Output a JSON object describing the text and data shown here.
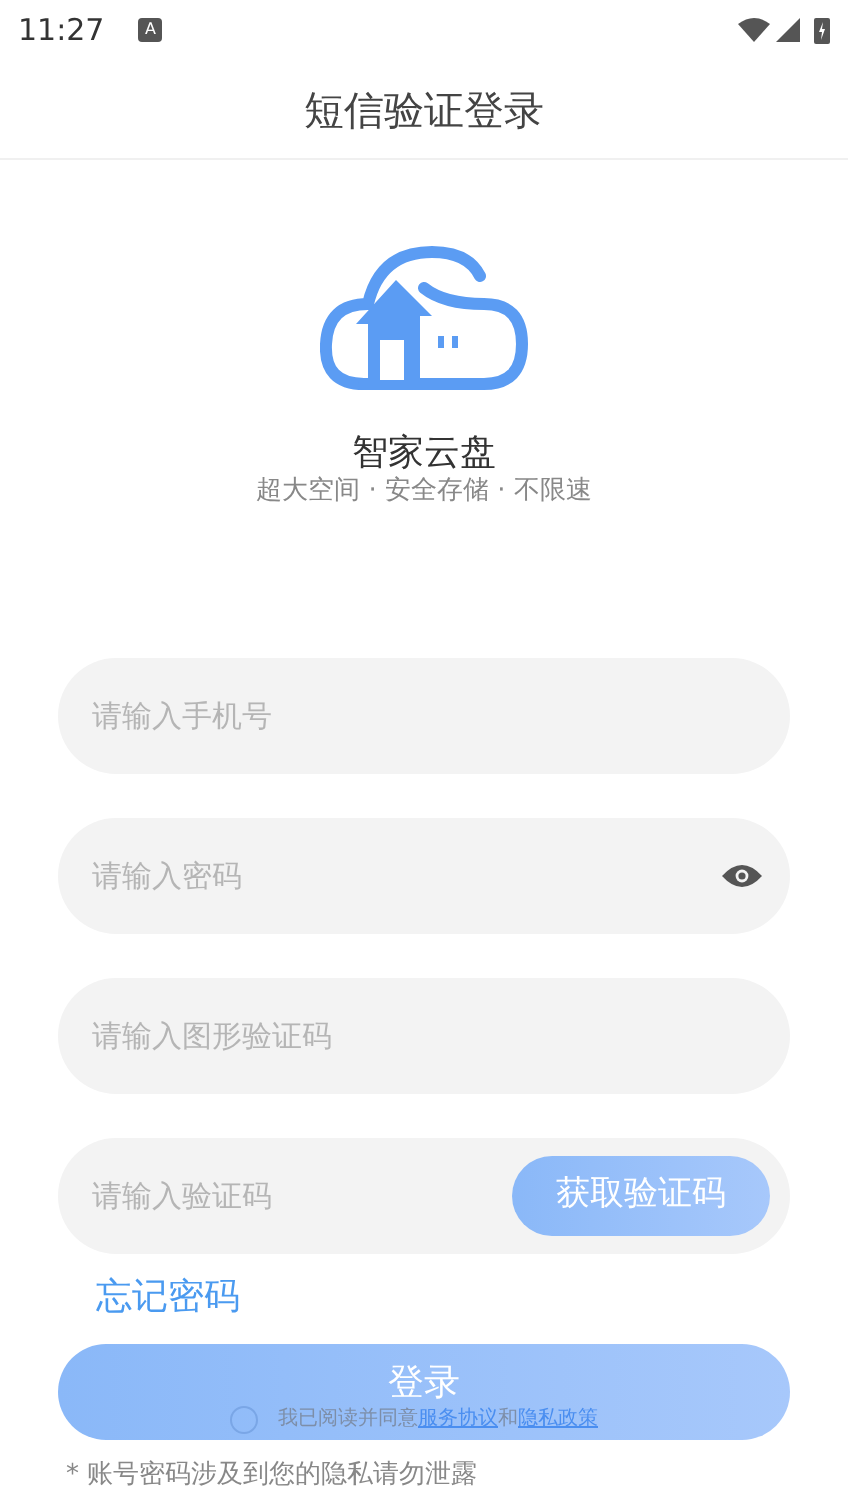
{
  "status_bar": {
    "time": "11:27",
    "badge": "A"
  },
  "header": {
    "title": "短信验证登录"
  },
  "brand": {
    "name": "智家云盘",
    "tagline": "超大空间 · 安全存储 · 不限速"
  },
  "fields": [
    {
      "kind": "phone",
      "placeholder": "请输入手机号"
    },
    {
      "kind": "password",
      "placeholder": "请输入密码"
    },
    {
      "kind": "captcha",
      "placeholder": "请输入图形验证码"
    },
    {
      "kind": "sms",
      "placeholder": "请输入验证码",
      "button": "获取验证码"
    }
  ],
  "forgot_link": "忘记密码",
  "login_button": {
    "label": "登录",
    "disabled": true
  },
  "agreement": {
    "checked": false,
    "text": "我已阅读并同意",
    "terms": "服务协议",
    "and": "和",
    "privacy": "隐私政策"
  },
  "note": "* 账号密码涉及到您的隐私请勿泄露"
}
